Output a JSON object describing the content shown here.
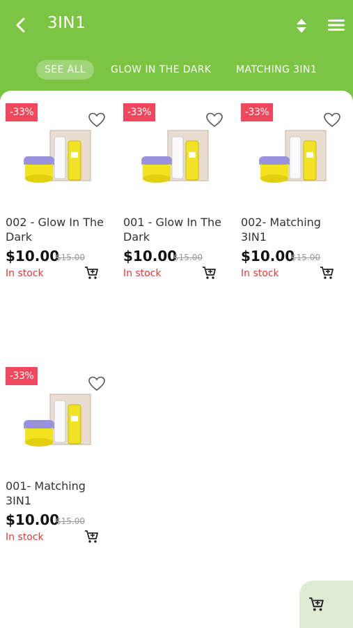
{
  "header": {
    "title": "3IN1",
    "back_icon": "chevron-left-icon",
    "sort_icon": "sort-icon",
    "menu_icon": "hamburger-menu-icon"
  },
  "tabs": [
    {
      "label": "SEE ALL",
      "active": true
    },
    {
      "label": "GLOW IN THE DARK",
      "active": false
    },
    {
      "label": "MATCHING 3IN1",
      "active": false
    }
  ],
  "products": [
    {
      "discount": "-33%",
      "name_line1": "002 - Glow In The",
      "name_line2": "Dark",
      "price": "$10.00",
      "old_price": "$15.00",
      "stock": "In stock"
    },
    {
      "discount": "-33%",
      "name_line1": "001 - Glow In The",
      "name_line2": "Dark",
      "price": "$10.00",
      "old_price": "$15.00",
      "stock": "In stock"
    },
    {
      "discount": "-33%",
      "name_line1": "002- Matching",
      "name_line2": "3IN1",
      "price": "$10.00",
      "old_price": "$15.00",
      "stock": "In stock"
    },
    {
      "discount": "-33%",
      "name_line1": "001- Matching",
      "name_line2": "3IN1",
      "price": "$10.00",
      "old_price": "$15.00",
      "stock": "In stock"
    }
  ],
  "colors": {
    "brand_green": "#7cc444",
    "badge_red": "#f0475c",
    "stock_red": "#e53935",
    "fab_bg": "#dcebd2"
  },
  "fab": {
    "icon": "add-to-cart-icon"
  }
}
